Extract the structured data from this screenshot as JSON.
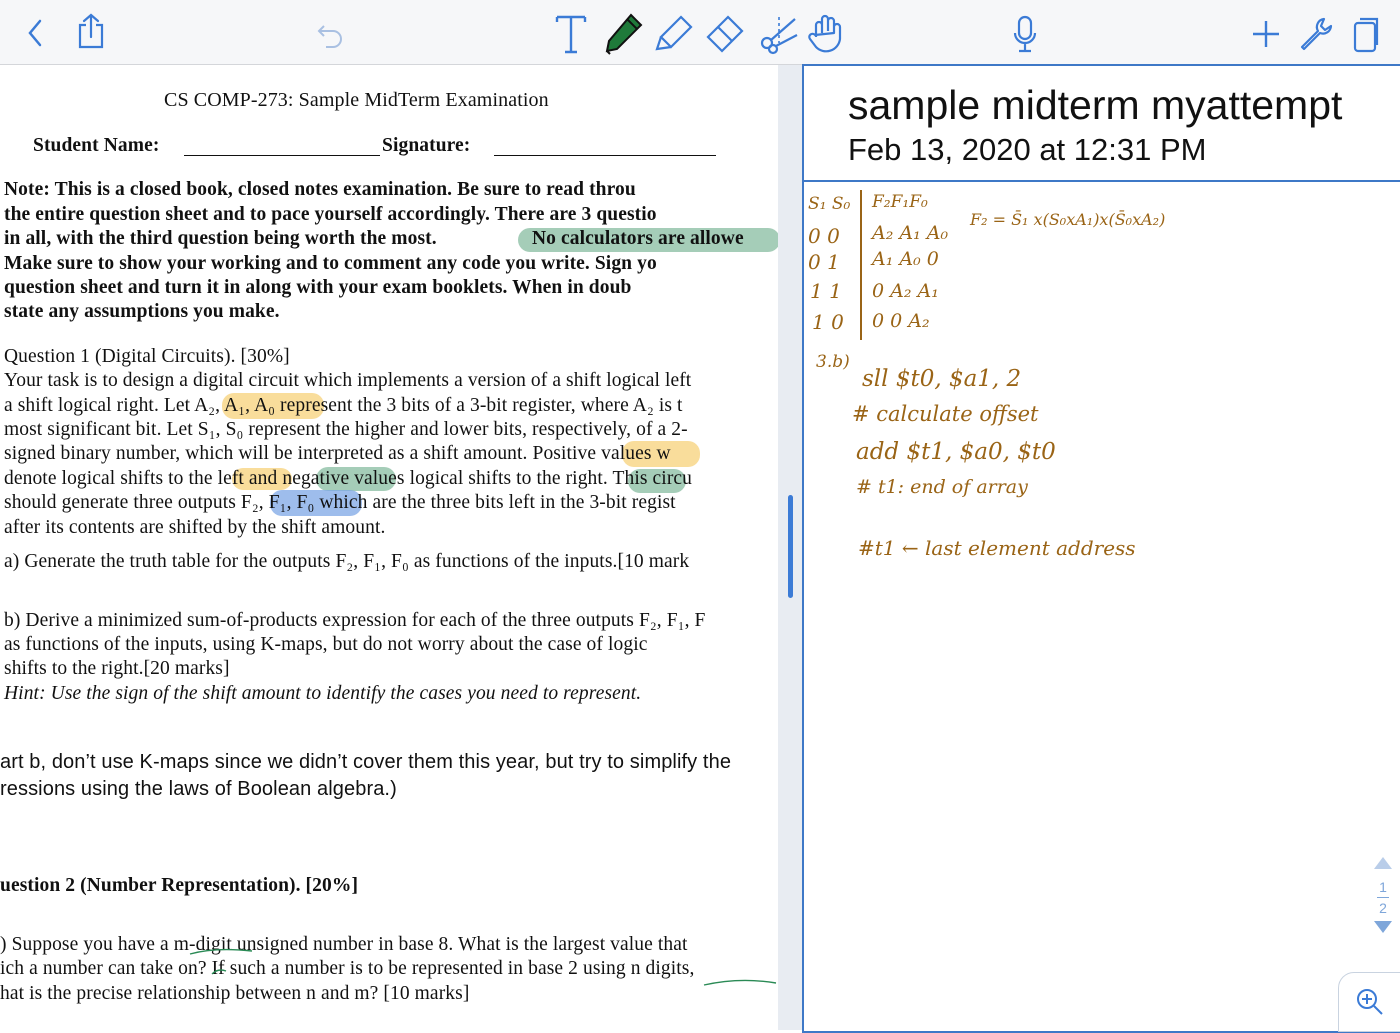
{
  "toolbar": {
    "left_icons": [
      "chevron-left-icon",
      "share-icon",
      "undo-icon"
    ],
    "tools": [
      "text-tool-icon",
      "pen-icon",
      "highlighter-icon",
      "eraser-icon",
      "scissors-icon",
      "hand-icon"
    ],
    "center_icon": "microphone-icon",
    "right_icons": [
      "plus-icon",
      "wrench-icon",
      "page-icon"
    ],
    "accent": "#3b7bd6",
    "pen_color": "#1f7a3a"
  },
  "pdf": {
    "title": "CS COMP-273: Sample MidTerm Examination",
    "student_label": "Student Name:",
    "signature_label": "Signature:",
    "note_lines": [
      "Note: This is a closed book, closed notes examination. Be sure to read throu",
      "the entire question sheet and to pace yourself accordingly. There are 3 questio",
      "in all, with the third question being worth the most.",
      "Make sure to show your working and to comment any code you write. Sign yo",
      "question sheet and turn it in along with your exam booklets. When in doub",
      "state any assumptions you make."
    ],
    "note_highlight": "No calculators are allowe",
    "q1_heading": "Question 1 (Digital Circuits). [30%]",
    "q1_lines": [
      "Your task is to design a digital circuit which implements a version of a shift logical left",
      "a shift logical right. Let A₂, A₁, A₀ represent the 3 bits of a 3-bit register, where A₂ is t",
      "most significant bit. Let S₁, S₀ represent the higher and lower bits, respectively, of a 2-",
      "signed binary number, which will be interpreted as a shift amount. Positive values w",
      "denote logical shifts to the left and negative values logical shifts to the right. This circu",
      "should generate three outputs F₂, F₁, F₀ which are the three bits left in the 3-bit regist",
      "after its contents are shifted by the shift amount."
    ],
    "q1a": "a) Generate the truth table for the outputs F₂, F₁, F₀ as functions of the inputs.[10 mark",
    "q1b_lines": [
      "b) Derive a minimized sum-of-products expression for each of the three outputs F₂, F₁, F",
      "as functions of the inputs, using K-maps, but do not worry about the case of logic",
      "shifts to the right.[20 marks]"
    ],
    "hint": "Hint: Use the sign of the shift amount to identify the cases you need to represent.",
    "instructor_note": [
      "art b, don’t use K-maps since we didn’t cover them this year, but try to simplify the",
      "ressions using the laws of Boolean algebra.)"
    ],
    "q2_heading": "uestion 2 (Number Representation). [20%]",
    "q2_lines": [
      ") Suppose you have a m-digit unsigned number in base 8. What is the largest value that",
      "ich a number can take on? If such a number is to be represented in base 2 using n digits,",
      "hat is the precise relationship between n and m? [10 marks]"
    ]
  },
  "notes": {
    "title": "sample midterm myattempt",
    "date": "Feb 13, 2020 at 12:31 PM",
    "handwriting": {
      "table_header": [
        "S₁ S₀",
        "F₂F₁F₀"
      ],
      "table_rows": [
        [
          "0 0",
          "A₂ A₁ A₀"
        ],
        [
          "0 1",
          "A₁ A₀ 0"
        ],
        [
          "1 1",
          "0 A₂ A₁"
        ],
        [
          "1 0",
          "0 0 A₂"
        ]
      ],
      "formula": "F₂ = S̄₁ x(S₀xA₁)x(S̄₀xA₂)",
      "label_3b": "3.b)",
      "code_lines": [
        "sll $t0, $a1, 2",
        "# calculate offset",
        "add $t1, $a0, $t0",
        "# t1: end of array",
        "#t1 ← last element address"
      ],
      "ink_color": "#9a6416"
    },
    "page_indicator": {
      "current": "1",
      "total": "2"
    },
    "zoom_icon": "zoom-in-icon"
  }
}
